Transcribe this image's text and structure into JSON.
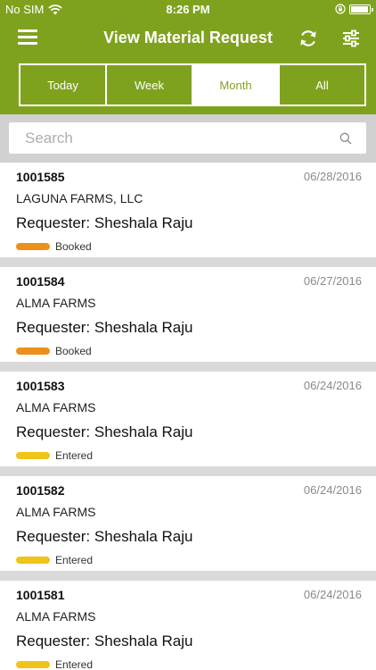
{
  "status_bar": {
    "carrier": "No SIM",
    "time": "8:26 PM"
  },
  "header": {
    "title": "View Material Request"
  },
  "tabs": [
    {
      "label": "Today",
      "active": false
    },
    {
      "label": "Week",
      "active": false
    },
    {
      "label": "Month",
      "active": true
    },
    {
      "label": "All",
      "active": false
    }
  ],
  "search": {
    "placeholder": "Search"
  },
  "colors": {
    "brand": "#7fa21e",
    "booked": "#ec9019",
    "entered": "#f0c419"
  },
  "requester_label": "Requester:",
  "requests": [
    {
      "id": "1001585",
      "date": "06/28/2016",
      "farm": "LAGUNA FARMS, LLC",
      "requester": "Sheshala Raju",
      "status": "Booked"
    },
    {
      "id": "1001584",
      "date": "06/27/2016",
      "farm": "ALMA FARMS",
      "requester": "Sheshala Raju",
      "status": "Booked"
    },
    {
      "id": "1001583",
      "date": "06/24/2016",
      "farm": "ALMA FARMS",
      "requester": "Sheshala Raju",
      "status": "Entered"
    },
    {
      "id": "1001582",
      "date": "06/24/2016",
      "farm": "ALMA FARMS",
      "requester": "Sheshala Raju",
      "status": "Entered"
    },
    {
      "id": "1001581",
      "date": "06/24/2016",
      "farm": "ALMA FARMS",
      "requester": "Sheshala Raju",
      "status": "Entered"
    }
  ]
}
